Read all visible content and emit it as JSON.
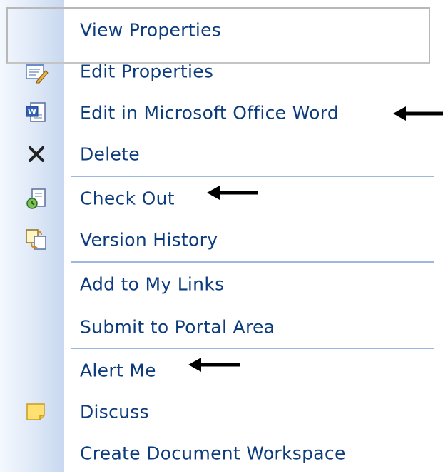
{
  "menu": {
    "items": [
      {
        "label": "View Properties",
        "icon": "none"
      },
      {
        "label": "Edit Properties",
        "icon": "edit-properties-icon"
      },
      {
        "label": "Edit in Microsoft Office Word",
        "icon": "word-document-icon"
      },
      {
        "label": "Delete",
        "icon": "delete-x-icon"
      },
      {
        "label": "Check Out",
        "icon": "check-out-icon"
      },
      {
        "label": "Version History",
        "icon": "version-history-icon"
      },
      {
        "label": "Add to My Links",
        "icon": "none"
      },
      {
        "label": "Submit to Portal Area",
        "icon": "none"
      },
      {
        "label": "Alert Me",
        "icon": "none"
      },
      {
        "label": "Discuss",
        "icon": "discuss-note-icon"
      },
      {
        "label": "Create Document Workspace",
        "icon": "none"
      }
    ]
  },
  "colors": {
    "label_text": "#0d3c7d",
    "separator": "#9eb7df",
    "gutter": "#c8d8f0",
    "arrow": "#000000"
  }
}
